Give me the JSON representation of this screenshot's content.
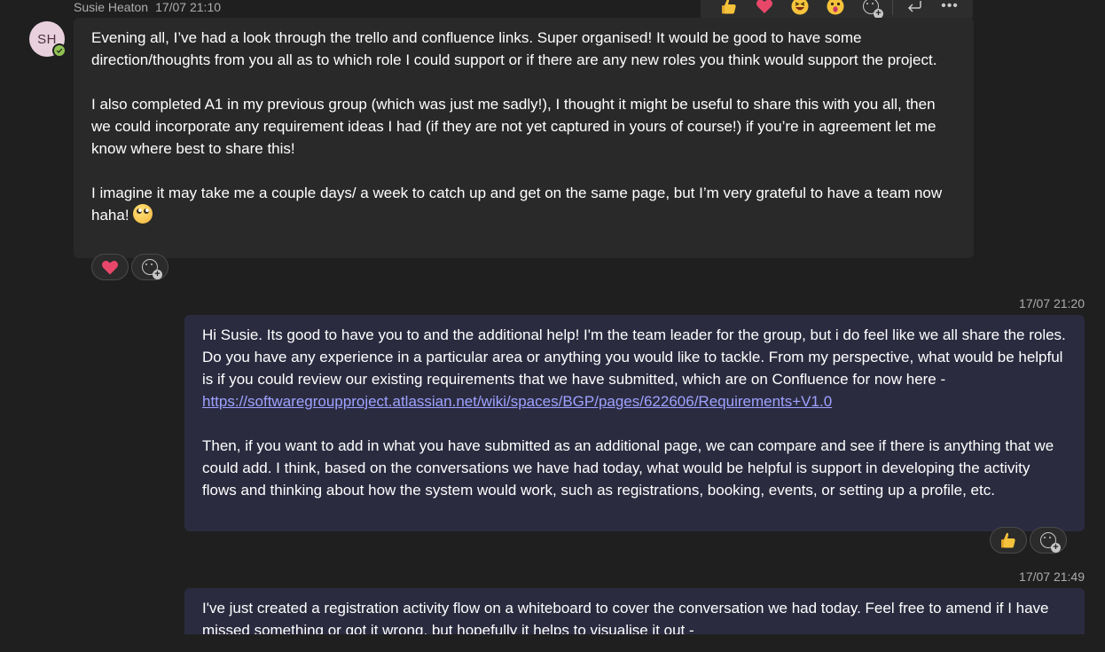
{
  "messages": {
    "incoming": {
      "avatar_initials": "SH",
      "sender": "Susie Heaton",
      "time": "17/07 21:10",
      "paragraphs": [
        "Evening all, I’ve had a look through the trello and confluence links. Super organised! It would be good to have some direction/thoughts from you all as to which role I could support or if there are any new roles you think would support the project.",
        "I also completed A1 in my previous group (which was just me sadly!), I thought it might be useful to share this with you all, then we could incorporate any requirement ideas I had (if they are not yet captured in yours of course!) if you’re in agreement let me know where best to share this!",
        "I imagine it may take me a couple days/ a week to catch up and get on the same page, but I’m very grateful to have a team now haha!"
      ],
      "reactions": [
        "heart-emoji"
      ]
    },
    "reply1": {
      "time": "17/07 21:20",
      "p1": "Hi Susie. Its good to have you to and the additional help! I'm the team leader for the group, but i do feel like we all share the roles. Do you have any experience in a particular area or anything you would like to tackle. From my perspective, what would be helpful is if you could review our existing requirements that we have submitted, which are on Confluence for now here -",
      "link": "https://softwaregroupproject.atlassian.net/wiki/spaces/BGP/pages/622606/Requirements+V1.0",
      "p2": "Then, if you want to add in what you have submitted as an additional page, we can compare and see if there is anything that we could add. I think, based on the conversations we have had today, what would be helpful is support in developing the activity flows and thinking about how the system would work, such as registrations, booking, events, or setting up a profile, etc.",
      "reactions": [
        "thumbs-up-emoji"
      ]
    },
    "reply2": {
      "time": "17/07 21:49",
      "p1": "I've just created a registration activity flow on a whiteboard to cover the conversation we had today. Feel free to amend if I have missed something or got it wrong, but hopefully it helps to visualise it out -"
    }
  },
  "toolbar": {
    "reactions": [
      "thumbs-up",
      "heart",
      "laugh",
      "surprised"
    ]
  },
  "colors": {
    "background": "#1f1f1f",
    "incoming_bubble": "#292929",
    "outgoing_bubble": "#2b2b40",
    "link": "#9ea2ff",
    "presence_available": "#92c353"
  }
}
